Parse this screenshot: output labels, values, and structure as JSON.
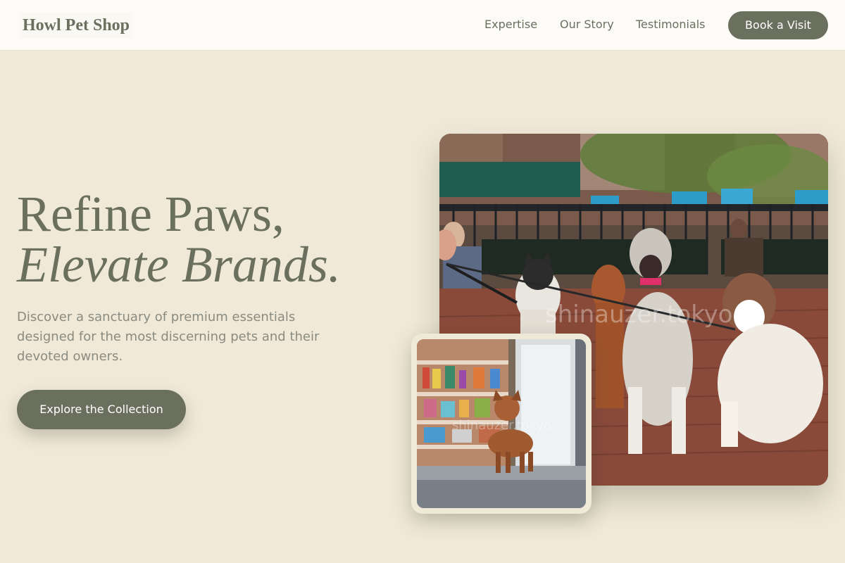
{
  "header": {
    "brand": "Howl Pet Shop",
    "nav": [
      {
        "label": "Expertise"
      },
      {
        "label": "Our Story"
      },
      {
        "label": "Testimonials"
      }
    ],
    "book_label": "Book a Visit"
  },
  "hero": {
    "title_line1": "Refine Paws,",
    "title_line2": "Elevate Brands.",
    "description": "Discover a sanctuary of premium essentials designed for the most discerning pets and their devoted owners.",
    "cta_label": "Explore the Collection"
  },
  "images": {
    "main_watermark": "shinauzer.tokyo",
    "small_watermark": "shinauzer.tokyo"
  },
  "colors": {
    "background": "#f0e9d8",
    "header_bg": "#fcfbf8",
    "accent": "#6b6f5e",
    "body_text": "#8a8b80"
  }
}
